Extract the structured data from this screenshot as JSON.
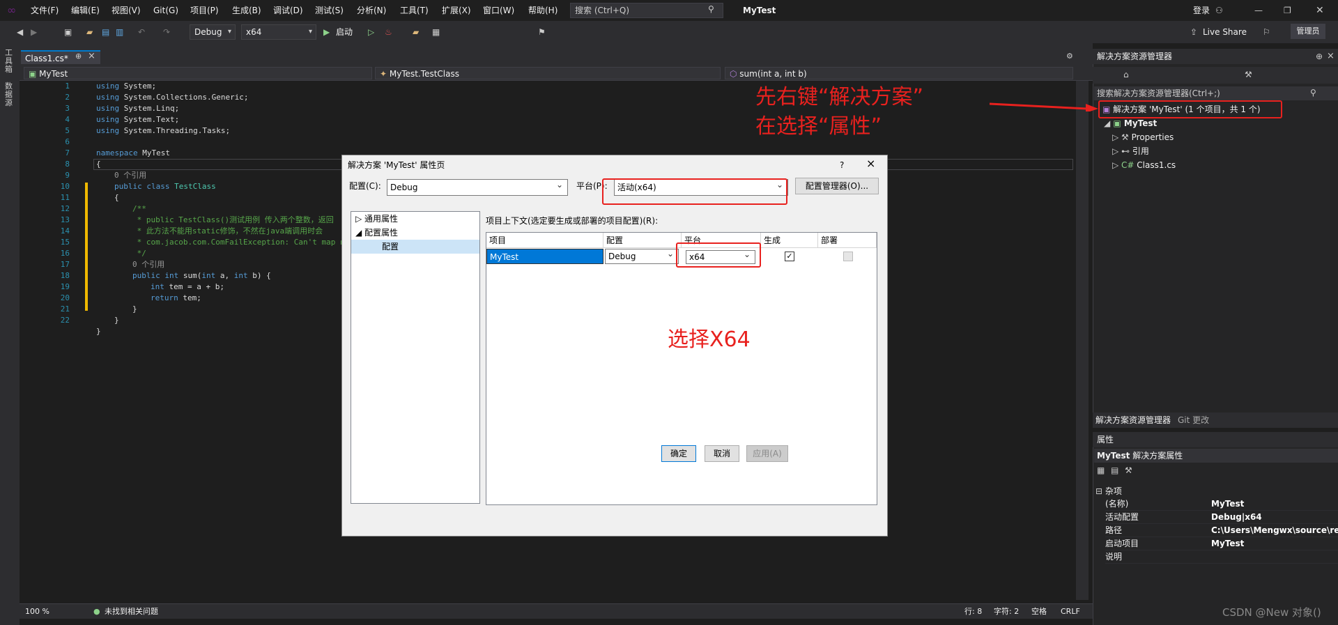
{
  "titlebar": {
    "menus": [
      "文件(F)",
      "编辑(E)",
      "视图(V)",
      "Git(G)",
      "项目(P)",
      "生成(B)",
      "调试(D)",
      "测试(S)",
      "分析(N)",
      "工具(T)",
      "扩展(X)",
      "窗口(W)",
      "帮助(H)"
    ],
    "search_placeholder": "搜索 (Ctrl+Q)",
    "app_title": "MyTest",
    "signin": "登录",
    "live_share": "Live Share",
    "admin_badge": "管理员"
  },
  "toolbar": {
    "config": "Debug",
    "platform": "x64",
    "start": "启动"
  },
  "left_strip": {
    "toolbox": "工具箱",
    "datasource": "数据源"
  },
  "doc_tab": {
    "title": "Class1.cs*",
    "pin": "⊕",
    "close": "×"
  },
  "navbar": {
    "project": "MyTest",
    "class": "MyTest.TestClass",
    "member": "sum(int a, int b)"
  },
  "code": {
    "line_numbers": [
      "1",
      "2",
      "3",
      "4",
      "5",
      "6",
      "7",
      "8",
      "9",
      "10",
      "11",
      "12",
      "13",
      "14",
      "15",
      "16",
      "17",
      "18",
      "19",
      "20",
      "21",
      "22"
    ],
    "ref0": "0 个引用",
    "ref1": "0 个引用"
  },
  "statusbar": {
    "zoom": "100 %",
    "issues": "未找到相关问题",
    "line": "行: 8",
    "char": "字符: 2",
    "space": "空格",
    "crlf": "CRLF"
  },
  "solution_explorer": {
    "title": "解决方案资源管理器",
    "search": "搜索解决方案资源管理器(Ctrl+;)",
    "solution_node": "解决方案 'MyTest' (1 个项目，共 1 个)",
    "project_node": "MyTest",
    "items": [
      "Properties",
      "引用",
      "Class1.cs"
    ],
    "tabs": [
      "解决方案资源管理器",
      "Git 更改"
    ]
  },
  "properties": {
    "title": "属性",
    "subject": "MyTest",
    "subject_desc": "解决方案属性",
    "category": "杂项",
    "rows": [
      {
        "key": "(名称)",
        "value": "MyTest"
      },
      {
        "key": "活动配置",
        "value": "Debug|x64"
      },
      {
        "key": "路径",
        "value": "C:\\Users\\Mengwx\\source\\rep"
      },
      {
        "key": "启动项目",
        "value": "MyTest"
      },
      {
        "key": "说明",
        "value": ""
      }
    ]
  },
  "dialog": {
    "title": "解决方案 'MyTest' 属性页",
    "help": "?",
    "close": "×",
    "config_label": "配置(C):",
    "config_value": "Debug",
    "platform_label": "平台(P):",
    "platform_value": "活动(x64)",
    "config_manager": "配置管理器(O)...",
    "tree": {
      "general": "通用属性",
      "config_props": "配置属性",
      "config_child": "配置"
    },
    "context_label": "项目上下文(选定要生成或部署的项目配置)(R):",
    "grid_headers": [
      "项目",
      "配置",
      "平台",
      "生成",
      "部署"
    ],
    "row": {
      "project": "MyTest",
      "config": "Debug",
      "platform": "x64"
    },
    "ok": "确定",
    "cancel": "取消",
    "apply": "应用(A)"
  },
  "annotations": {
    "step1_line1": "先右键“解决方案”",
    "step1_line2": "在选择“属性”",
    "step2": "选择X64",
    "color": "#e8211e"
  },
  "watermark": "CSDN @New 对象()"
}
